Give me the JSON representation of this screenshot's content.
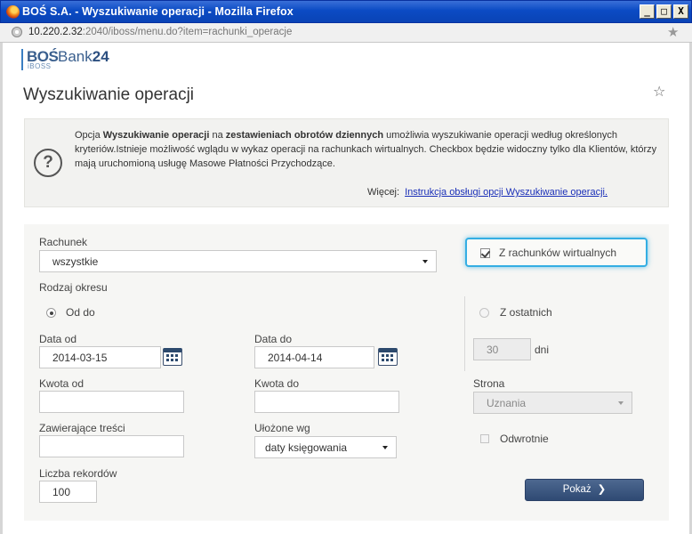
{
  "window": {
    "title": "BOŚ S.A. - Wyszukiwanie operacji - Mozilla Firefox",
    "controls": {
      "minimize": "_",
      "maximize": "□",
      "close": "X"
    }
  },
  "address_bar": {
    "host": "10.220.2.32",
    "path": ":2040/iboss/menu.do?item=rachunki_operacje"
  },
  "logo": {
    "bos": "BOŚ",
    "bank": "Bank",
    "num": "24",
    "sub": "iBOSS"
  },
  "page": {
    "title": "Wyszukiwanie operacji"
  },
  "info": {
    "part1": "Opcja ",
    "bold1": "Wyszukiwanie operacji",
    "part2": " na ",
    "bold2": "zestawieniach obrotów dziennych",
    "part3": " umożliwia wyszukiwanie operacji według określonych kryteriów.Istnieje możliwość wglądu w wykaz operacji na rachunkach wirtualnych. Checkbox będzie widoczny tylko dla Klientów, którzy mają uruchomioną usługę Masowe Płatności Przychodzące.",
    "more_label": "Więcej:",
    "more_link": "Instrukcja obsługi opcji Wyszukiwanie operacji."
  },
  "form": {
    "account_label": "Rachunek",
    "account_value": "wszystkie",
    "virtual_label": "Z rachunków wirtualnych",
    "virtual_checked": true,
    "period_label": "Rodzaj okresu",
    "radio_from_to": "Od do",
    "radio_last": "Z ostatnich",
    "date_from_label": "Data od",
    "date_from_value": "2014-03-15",
    "date_to_label": "Data do",
    "date_to_value": "2014-04-14",
    "days_value": "30",
    "days_label": "dni",
    "amount_from_label": "Kwota od",
    "amount_from_value": "",
    "amount_to_label": "Kwota do",
    "amount_to_value": "",
    "side_label": "Strona",
    "side_value": "Uznania",
    "contains_label": "Zawierające treści",
    "contains_value": "",
    "sort_label": "Ułożone wg",
    "sort_value": "daty księgowania",
    "reverse_label": "Odwrotnie",
    "records_label": "Liczba rekordów",
    "records_value": "100",
    "show_button": "Pokaż",
    "show_chev": "❯"
  },
  "colors": {
    "titlebar": "#0b4bc4",
    "highlight": "#34aee3",
    "button": "#3a5680",
    "link": "#1a2fb8"
  }
}
